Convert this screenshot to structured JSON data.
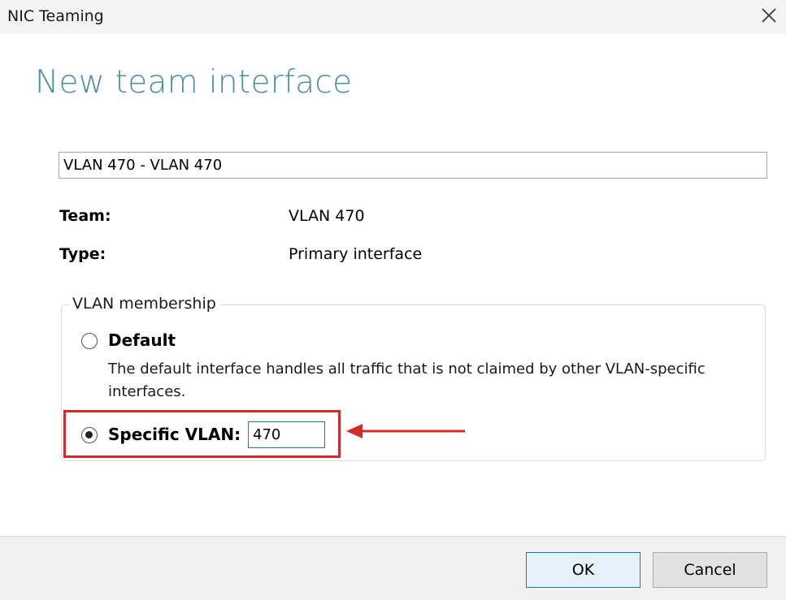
{
  "window": {
    "title": "NIC Teaming",
    "close_icon": "close-icon"
  },
  "heading": "New team interface",
  "interface_name": {
    "value": "VLAN 470 - VLAN 470"
  },
  "fields": {
    "team_label": "Team:",
    "team_value": "VLAN 470",
    "type_label": "Type:",
    "type_value": "Primary interface"
  },
  "vlan_membership": {
    "legend": "VLAN membership",
    "default_option": {
      "label": "Default",
      "checked": false,
      "description": "The default interface handles all traffic that is not claimed by other VLAN-specific interfaces."
    },
    "specific_option": {
      "label": "Specific VLAN:",
      "checked": true,
      "value": "470"
    }
  },
  "annotation": {
    "highlight_color": "#d42a2a",
    "arrow_color": "#d42a2a"
  },
  "buttons": {
    "ok": "OK",
    "cancel": "Cancel"
  },
  "colors": {
    "heading": "#4a8fa6",
    "focus_border": "#0a78d4"
  }
}
